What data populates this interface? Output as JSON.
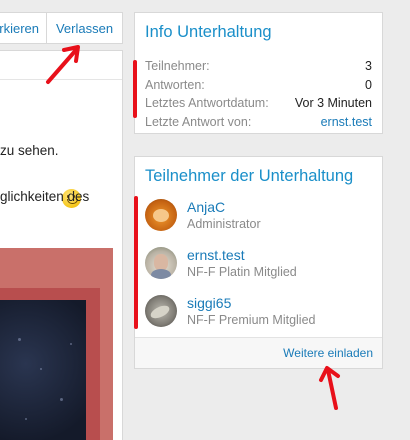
{
  "toolbar": {
    "mark_label": "rkieren",
    "leave_label": "Verlassen"
  },
  "post": {
    "line1": "zu sehen.",
    "line2": "glichkeiten des",
    "emoji": "smiley-icon"
  },
  "info": {
    "title": "Info Unterhaltung",
    "rows": [
      {
        "label": "Teilnehmer:",
        "value": "3"
      },
      {
        "label": "Antworten:",
        "value": "0"
      },
      {
        "label": "Letztes Antwortdatum:",
        "value": "Vor 3 Minuten"
      },
      {
        "label": "Letzte Antwort von:",
        "value": "ernst.test"
      }
    ]
  },
  "participants": {
    "title": "Teilnehmer der Unterhaltung",
    "members": [
      {
        "name": "AnjaC",
        "role": "Administrator"
      },
      {
        "name": "ernst.test",
        "role": "NF-F Platin Mitglied"
      },
      {
        "name": "siggi65",
        "role": "NF-F Premium Mitglied"
      }
    ],
    "invite_label": "Weitere einladen"
  },
  "colors": {
    "accent": "#1a8fc9",
    "link": "#1a7bb8",
    "annotation": "#e8101a"
  }
}
